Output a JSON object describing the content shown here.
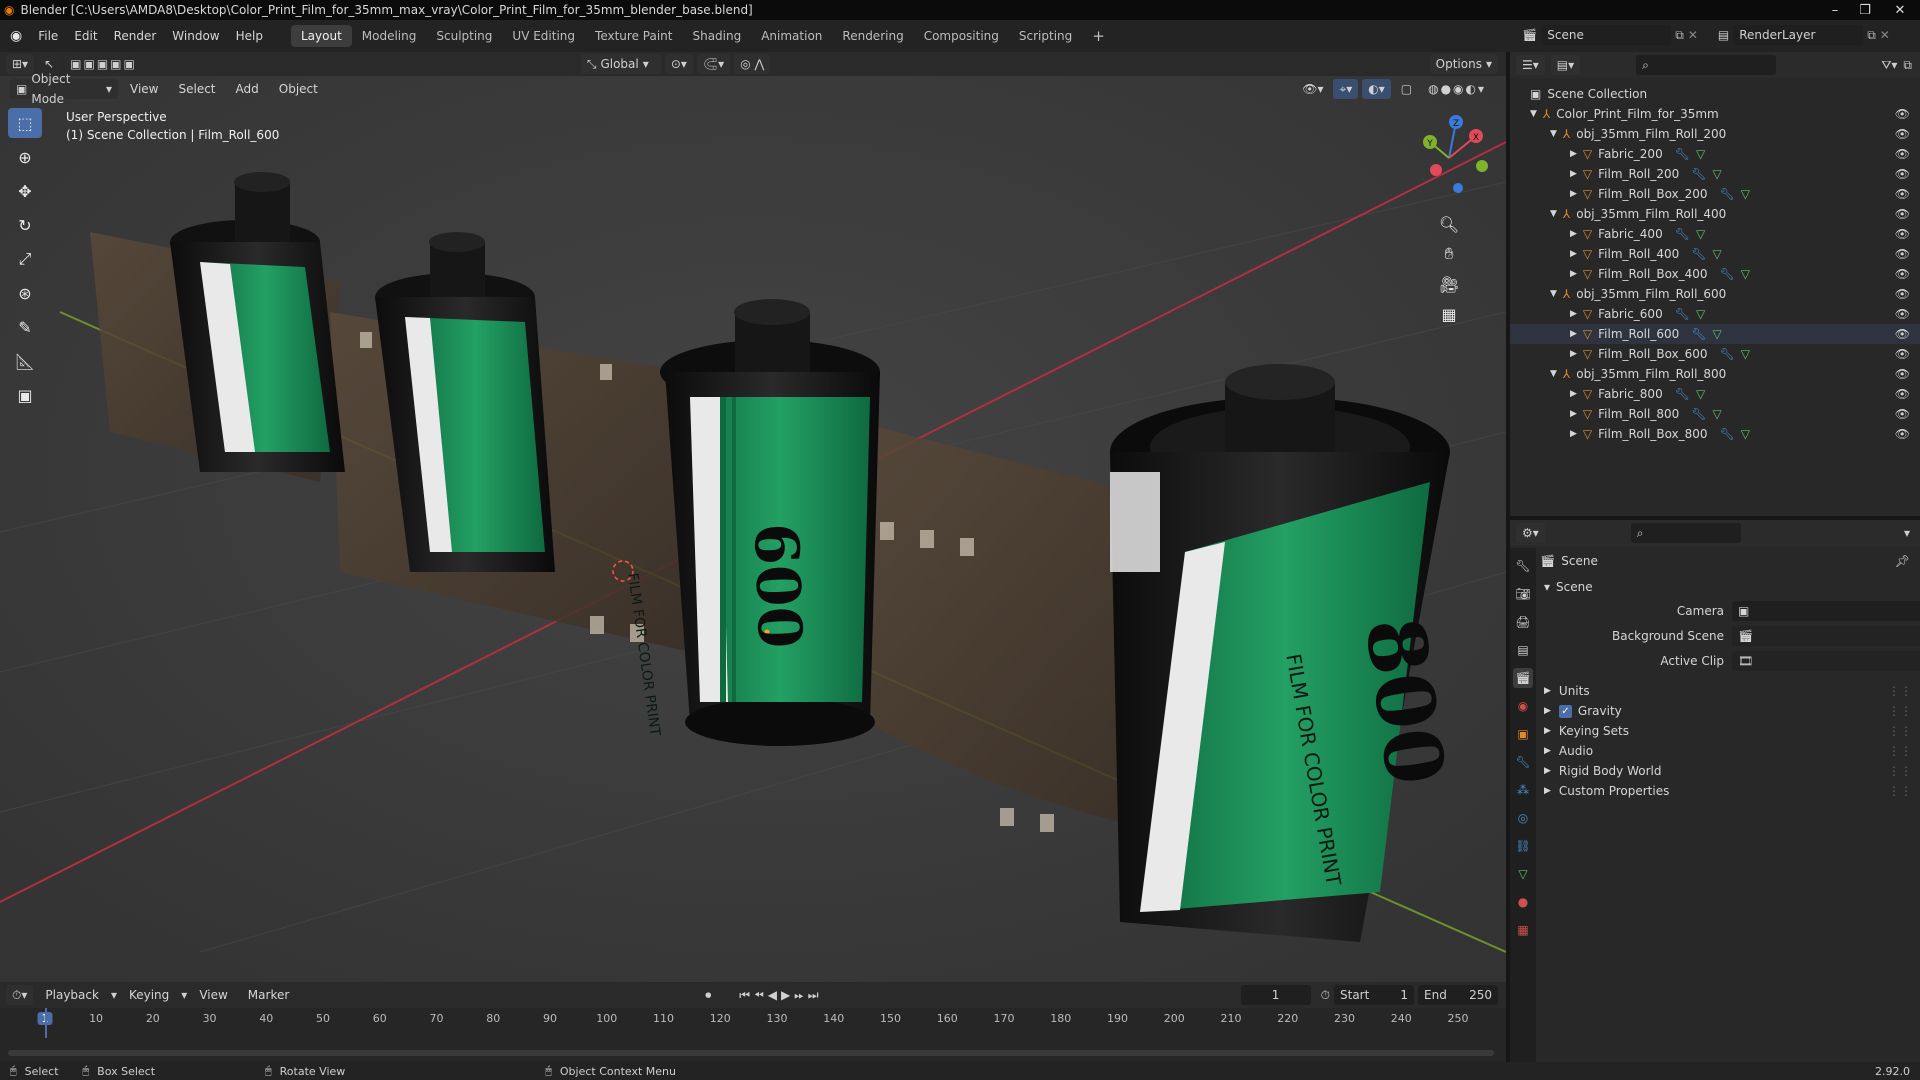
{
  "titlebar": {
    "title": "Blender [C:\\Users\\AMDA8\\Desktop\\Color_Print_Film_for_35mm_max_vray\\Color_Print_Film_for_35mm_blender_base.blend]"
  },
  "menubar": {
    "menus": [
      "File",
      "Edit",
      "Render",
      "Window",
      "Help"
    ],
    "workspaces": [
      "Layout",
      "Modeling",
      "Sculpting",
      "UV Editing",
      "Texture Paint",
      "Shading",
      "Animation",
      "Rendering",
      "Compositing",
      "Scripting"
    ],
    "active_workspace": "Layout",
    "scene": "Scene",
    "view_layer": "RenderLayer"
  },
  "viewport": {
    "transform_orientation": "Global",
    "options_label": "Options",
    "mode": "Object Mode",
    "menus": [
      "View",
      "Select",
      "Add",
      "Object"
    ],
    "overlay_line1": "User Perspective",
    "overlay_line2": "(1) Scene Collection | Film_Roll_600",
    "labels": {
      "film_text": "FILM FOR COLOR PRINT",
      "roll_600": "600",
      "roll_800": "800"
    },
    "gizmo": {
      "x": "X",
      "y": "Y",
      "z": "Z"
    }
  },
  "outliner": {
    "root": "Scene Collection",
    "rows": [
      {
        "label": "Color_Print_Film_for_35mm",
        "depth": 0,
        "kind": "empty",
        "expanded": true
      },
      {
        "label": "obj_35mm_Film_Roll_200",
        "depth": 1,
        "kind": "empty",
        "expanded": true
      },
      {
        "label": "Fabric_200",
        "depth": 2,
        "kind": "mesh",
        "expanded": false
      },
      {
        "label": "Film_Roll_200",
        "depth": 2,
        "kind": "mesh",
        "expanded": false
      },
      {
        "label": "Film_Roll_Box_200",
        "depth": 2,
        "kind": "mesh",
        "expanded": false
      },
      {
        "label": "obj_35mm_Film_Roll_400",
        "depth": 1,
        "kind": "empty",
        "expanded": true
      },
      {
        "label": "Fabric_400",
        "depth": 2,
        "kind": "mesh",
        "expanded": false
      },
      {
        "label": "Film_Roll_400",
        "depth": 2,
        "kind": "mesh",
        "expanded": false
      },
      {
        "label": "Film_Roll_Box_400",
        "depth": 2,
        "kind": "mesh",
        "expanded": false
      },
      {
        "label": "obj_35mm_Film_Roll_600",
        "depth": 1,
        "kind": "empty",
        "expanded": true
      },
      {
        "label": "Fabric_600",
        "depth": 2,
        "kind": "mesh",
        "expanded": false
      },
      {
        "label": "Film_Roll_600",
        "depth": 2,
        "kind": "mesh",
        "expanded": false
      },
      {
        "label": "Film_Roll_Box_600",
        "depth": 2,
        "kind": "mesh",
        "expanded": false
      },
      {
        "label": "obj_35mm_Film_Roll_800",
        "depth": 1,
        "kind": "empty",
        "expanded": true
      },
      {
        "label": "Fabric_800",
        "depth": 2,
        "kind": "mesh",
        "expanded": false
      },
      {
        "label": "Film_Roll_800",
        "depth": 2,
        "kind": "mesh",
        "expanded": false
      },
      {
        "label": "Film_Roll_Box_800",
        "depth": 2,
        "kind": "mesh",
        "expanded": false
      }
    ]
  },
  "properties": {
    "context": "Scene",
    "panel": "Scene",
    "camera_label": "Camera",
    "background_scene_label": "Background Scene",
    "active_clip_label": "Active Clip",
    "sections": [
      "Units",
      "Gravity",
      "Keying Sets",
      "Audio",
      "Rigid Body World",
      "Custom Properties"
    ],
    "gravity_checked": true
  },
  "timeline": {
    "menus": [
      "Playback",
      "Keying",
      "View",
      "Marker"
    ],
    "current_frame": "1",
    "start_label": "Start",
    "start": "1",
    "end_label": "End",
    "end": "250",
    "ticks": [
      "1",
      "10",
      "20",
      "30",
      "40",
      "50",
      "60",
      "70",
      "80",
      "90",
      "100",
      "110",
      "120",
      "130",
      "140",
      "150",
      "160",
      "170",
      "180",
      "190",
      "200",
      "210",
      "220",
      "230",
      "240",
      "250"
    ]
  },
  "statusbar": {
    "select": "Select",
    "box_select": "Box Select",
    "rotate_view": "Rotate View",
    "context_menu": "Object Context Menu",
    "version": "2.92.0"
  },
  "colors": {
    "accent": "#4b6ea9",
    "label_green": "#1f8a55",
    "axis_x": "#e04a5a",
    "axis_y": "#7fb22d",
    "axis_z": "#3a7ad8"
  }
}
